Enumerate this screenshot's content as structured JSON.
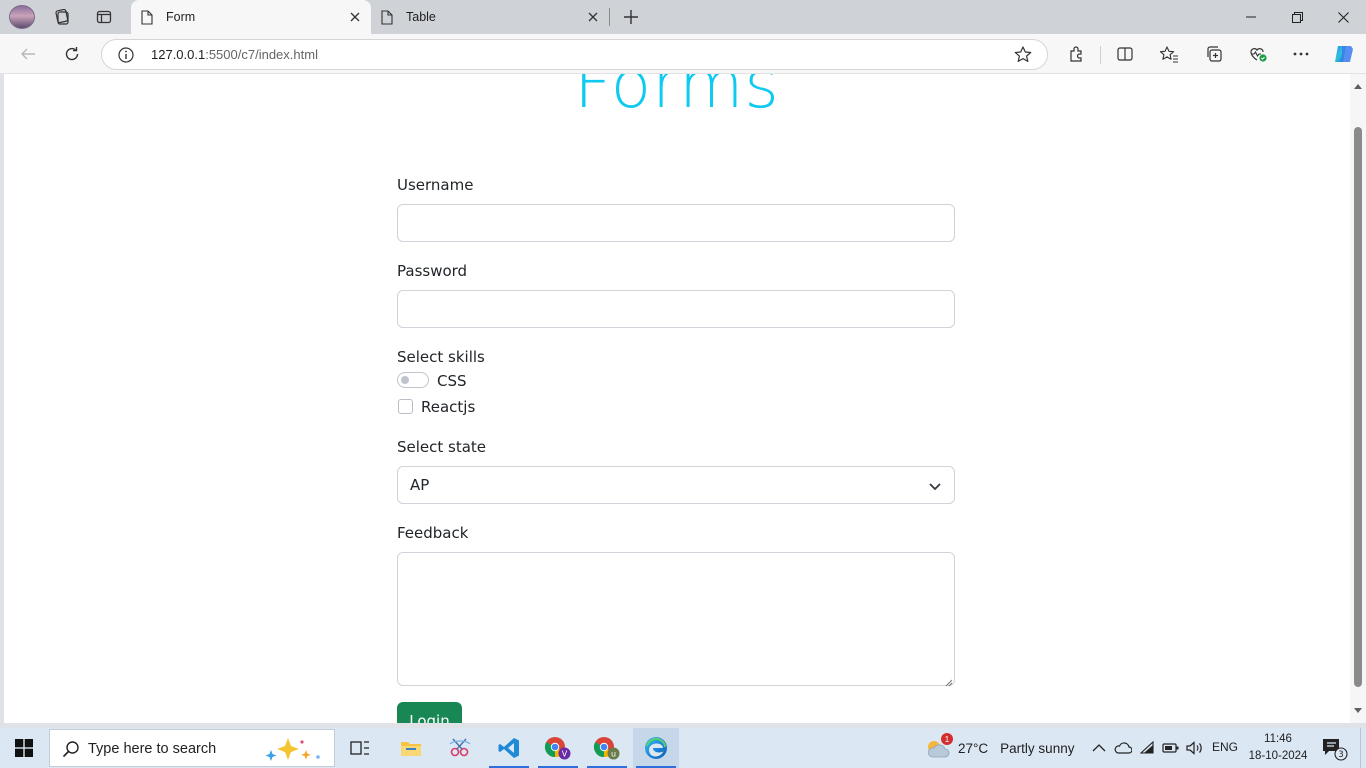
{
  "browser": {
    "tabs": [
      {
        "label": "Form",
        "active": true
      },
      {
        "label": "Table",
        "active": false
      }
    ],
    "url": {
      "host": "127.0.0.1",
      "path": ":5500/c7/index.html"
    }
  },
  "page": {
    "heading": "Forms",
    "username_label": "Username",
    "password_label": "Password",
    "skills_label": "Select skills",
    "skill_css": "CSS",
    "skill_reactjs": "Reactjs",
    "state_label": "Select state",
    "state_value": "AP",
    "feedback_label": "Feedback",
    "login_button": "Login",
    "accent_color": "#0dcaf0",
    "button_color": "#198754"
  },
  "taskbar": {
    "search_placeholder": "Type here to search",
    "weather_badge": "1",
    "temperature": "27°C",
    "weather": "Partly sunny",
    "language": "ENG",
    "time": "11:46",
    "date": "18-10-2024",
    "notifications": "3",
    "chrome_profile_1": "V",
    "chrome_profile_2": "u"
  }
}
